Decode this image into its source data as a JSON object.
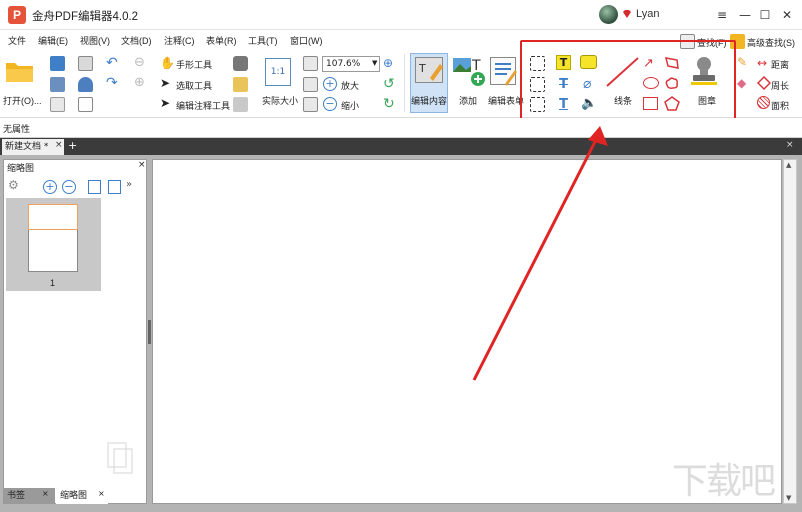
{
  "title": {
    "logo_letter": "P",
    "app_name": "金舟PDF编辑器4.0.2",
    "user": "Lyan"
  },
  "window_controls": {
    "minimize": "—",
    "maximize": "☐",
    "close": "✕",
    "restore": "≡"
  },
  "menu": [
    "文件",
    "编辑(E)",
    "视图(V)",
    "文档(D)",
    "注释(C)",
    "表单(R)",
    "工具(T)",
    "窗口(W)"
  ],
  "ribbon": {
    "open": "打开(O)...",
    "hand_tool": "手形工具",
    "select_tool": "选取工具",
    "edit_annot_tool": "编辑注释工具",
    "actual_size": "实际大小",
    "zoom_value": "107.6%",
    "zoom_in": "放大",
    "zoom_out": "缩小",
    "edit_content": "编辑内容",
    "add": "添加",
    "edit_form": "编辑表单",
    "line": "线条",
    "stamp": "图章",
    "find": "查找(F)",
    "adv_find": "高级查找(S)",
    "distance": "距离",
    "perimeter": "周长",
    "area": "面积",
    "actual_icon": "1:1"
  },
  "props": {
    "label": "无属性"
  },
  "tabs": {
    "doc": "新建文档 *",
    "close": "×",
    "add": "+"
  },
  "thumb_panel": {
    "title": "缩略图",
    "close": "×",
    "page_num": "1",
    "bottom_tab_bookmark": "书签",
    "bottom_tab_thumb": "缩略图"
  },
  "colors": {
    "accent": "#e02424",
    "highlight_border": "#e02424",
    "tab_bar": "#3b3b3b",
    "workspace": "#b4b4b4"
  },
  "watermark": "下载吧"
}
